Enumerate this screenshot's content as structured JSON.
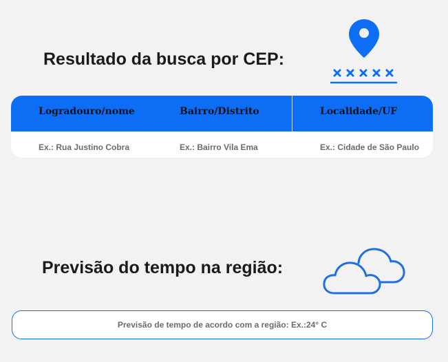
{
  "cep_section": {
    "title": "Resultado da busca por CEP:",
    "pin_icon": "location-pin-icon",
    "masked_code_icon": "masked-code-icon",
    "table": {
      "headers": [
        "Logradouro/nome",
        "Bairro/Distrito",
        "Localidade/UF"
      ],
      "row": [
        "Ex.: Rua Justino Cobra",
        "Ex.: Bairro Vila Ema",
        "Ex.: Cidade de São Paulo"
      ]
    }
  },
  "weather_section": {
    "title": "Previsão do tempo na região:",
    "cloud_icon": "clouds-icon",
    "forecast_text": "Previsão de tempo de acordo com a região: Ex.:24° C"
  },
  "colors": {
    "accent": "#0d6ef5",
    "background": "#f2f2f2",
    "title_text": "#1a1a1a",
    "muted_text": "#6b6b6b"
  }
}
